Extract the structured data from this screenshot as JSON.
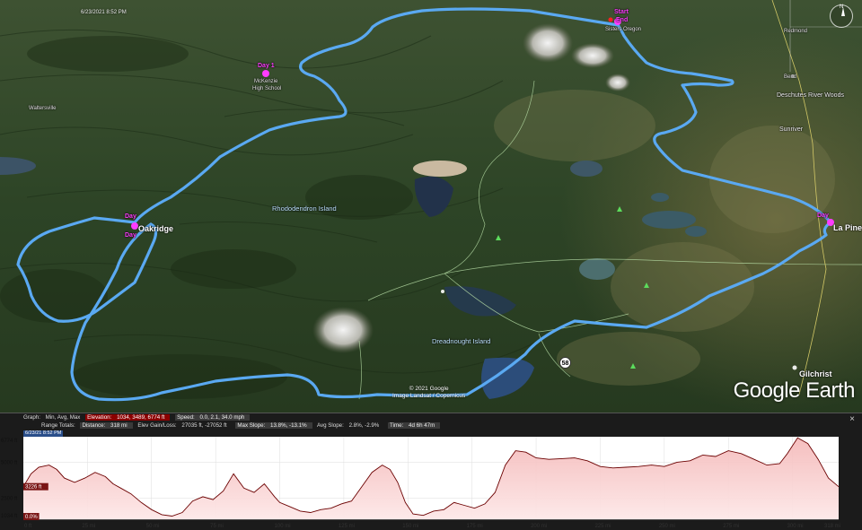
{
  "map": {
    "timestamp": "6/23/2021  8:52 PM",
    "labels": {
      "start": "Start",
      "end": "End",
      "sisters": "Sisters Oregon",
      "day1": "Day 1",
      "day2a": "Day",
      "day2b": "Day",
      "day3": "Day",
      "mckenzie1": "McKenzie",
      "mckenzie2": "High School",
      "oakridge": "Oakridge",
      "lapine": "La Pine",
      "gilchrist": "Gilchrist",
      "sunriver": "Sunriver",
      "redmond": "Redmond",
      "bend": "Bend",
      "deschutes": "Deschutes River Woods",
      "rhododendron": "Rhododendron Island",
      "dreadnought": "Dreadnought Island",
      "waltersville": "Waltersville",
      "route_shield": "58"
    },
    "copyright1": "© 2021 Google",
    "copyright2": "Image Landsat / Copernicus",
    "logo": "Google Earth",
    "route_color": "#5aa9f2",
    "marker_color": "#ff3cff"
  },
  "profile": {
    "graph_label": "Graph:",
    "graph_value": "Min, Avg, Max",
    "elevation_label": "Elevation:",
    "elevation_value": "1034, 3489, 6774 ft",
    "speed_label": "Speed:",
    "speed_value": "0.0, 2.1, 34.0 mph",
    "range_label": "Range Totals:",
    "distance_label": "Distance:",
    "distance_value": "318 mi",
    "gain_label": "Elev Gain/Loss:",
    "gain_value": "27035 ft, -27052 ft",
    "maxslope_label": "Max Slope:",
    "maxslope_value": "13.8%, -13.1%",
    "avgslope_label": "Avg Slope:",
    "avgslope_value": "2.8%, -2.9%",
    "time_label": "Time:",
    "time_value": "4d 6h 47m",
    "date_value": "6/23/21 8:52 PM",
    "close_glyph": "×"
  },
  "chart_data": {
    "type": "area",
    "xlabel": "",
    "ylabel": "",
    "x_unit": "mi",
    "y_unit": "ft",
    "xlim": [
      0,
      318
    ],
    "ylim": [
      1034,
      6774
    ],
    "x_ticks": [
      "0 ft",
      "25 mi",
      "50 mi",
      "75 mi",
      "100 mi",
      "125 mi",
      "150 mi",
      "175 mi",
      "200 mi",
      "225 mi",
      "250 mi",
      "275 mi",
      "300 mi",
      "318 mi"
    ],
    "y_ticks": [
      "6774 ft",
      "5000 ft",
      "2500 ft",
      "1034 ft"
    ],
    "y_tick_values": [
      6774,
      5000,
      2500,
      1034
    ],
    "current_value_label": "3226 ft",
    "slope_label": "0.0%",
    "fill_color": "#f4b8b8",
    "line_color": "#6b0000",
    "x": [
      0,
      3,
      6,
      10,
      13,
      16,
      20,
      24,
      28,
      32,
      35,
      38,
      42,
      46,
      50,
      54,
      58,
      62,
      66,
      70,
      74,
      78,
      82,
      86,
      90,
      94,
      98,
      100,
      104,
      108,
      112,
      116,
      120,
      124,
      128,
      132,
      136,
      140,
      143,
      146,
      149,
      152,
      156,
      160,
      164,
      168,
      172,
      176,
      180,
      184,
      188,
      192,
      196,
      200,
      205,
      210,
      215,
      220,
      225,
      230,
      235,
      240,
      245,
      250,
      255,
      260,
      265,
      270,
      275,
      280,
      285,
      290,
      295,
      298,
      302,
      306,
      310,
      314,
      318
    ],
    "y": [
      3300,
      4200,
      4650,
      4800,
      4500,
      3900,
      3600,
      3900,
      4300,
      4000,
      3500,
      3200,
      2800,
      2200,
      1700,
      1350,
      1250,
      1500,
      2300,
      2600,
      2400,
      3000,
      4200,
      3200,
      2900,
      3500,
      2600,
      2200,
      1900,
      1600,
      1500,
      1700,
      1800,
      2100,
      2300,
      3300,
      4300,
      4800,
      4500,
      3600,
      2200,
      1400,
      1300,
      1600,
      1700,
      2200,
      2000,
      1800,
      2100,
      2900,
      4800,
      5800,
      5700,
      5300,
      5200,
      5250,
      5300,
      5100,
      4700,
      4600,
      4650,
      4700,
      4800,
      4700,
      5000,
      5100,
      5500,
      5400,
      5800,
      5600,
      5200,
      4800,
      4900,
      5600,
      6700,
      6300,
      5200,
      3900,
      3300
    ]
  }
}
